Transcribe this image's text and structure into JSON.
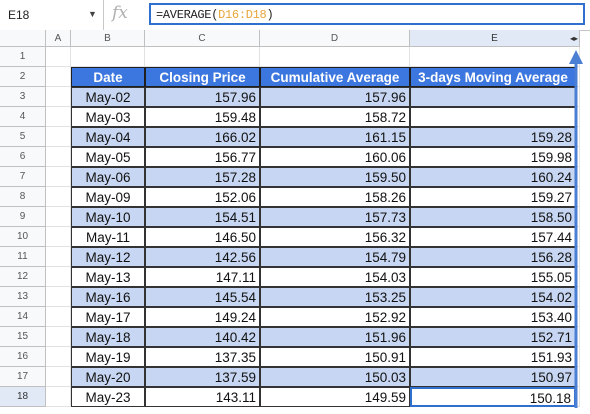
{
  "formula_bar": {
    "name_box": "E18",
    "fx_label": "fx",
    "formula_prefix": "=AVERAGE(",
    "formula_range": "D16:D18",
    "formula_suffix": ")"
  },
  "columns": [
    "A",
    "B",
    "C",
    "D",
    "E"
  ],
  "rows": [
    "1",
    "2",
    "3",
    "4",
    "5",
    "6",
    "7",
    "8",
    "9",
    "10",
    "11",
    "12",
    "13",
    "14",
    "15",
    "16",
    "17",
    "18"
  ],
  "table": {
    "headers": [
      "Date",
      "Closing Price",
      "Cumulative Average",
      "3-days Moving Average"
    ],
    "rows": [
      [
        "May-02",
        "157.96",
        "157.96",
        ""
      ],
      [
        "May-03",
        "159.48",
        "158.72",
        ""
      ],
      [
        "May-04",
        "166.02",
        "161.15",
        "159.28"
      ],
      [
        "May-05",
        "156.77",
        "160.06",
        "159.98"
      ],
      [
        "May-06",
        "157.28",
        "159.50",
        "160.24"
      ],
      [
        "May-09",
        "152.06",
        "158.26",
        "159.27"
      ],
      [
        "May-10",
        "154.51",
        "157.73",
        "158.50"
      ],
      [
        "May-11",
        "146.50",
        "156.32",
        "157.44"
      ],
      [
        "May-12",
        "142.56",
        "154.79",
        "156.28"
      ],
      [
        "May-13",
        "147.11",
        "154.03",
        "155.05"
      ],
      [
        "May-16",
        "145.54",
        "153.25",
        "154.02"
      ],
      [
        "May-17",
        "149.24",
        "152.92",
        "153.40"
      ],
      [
        "May-18",
        "140.42",
        "151.96",
        "152.71"
      ],
      [
        "May-19",
        "137.35",
        "150.91",
        "151.93"
      ],
      [
        "May-20",
        "137.59",
        "150.03",
        "150.97"
      ],
      [
        "May-23",
        "143.11",
        "149.59",
        "150.18"
      ]
    ]
  },
  "selected_cell": "E18",
  "colors": {
    "header_bg": "#3c77e0",
    "band_bg": "#c7d6f2",
    "selection": "#2f6fce",
    "formula_range": "#e8a53a"
  }
}
